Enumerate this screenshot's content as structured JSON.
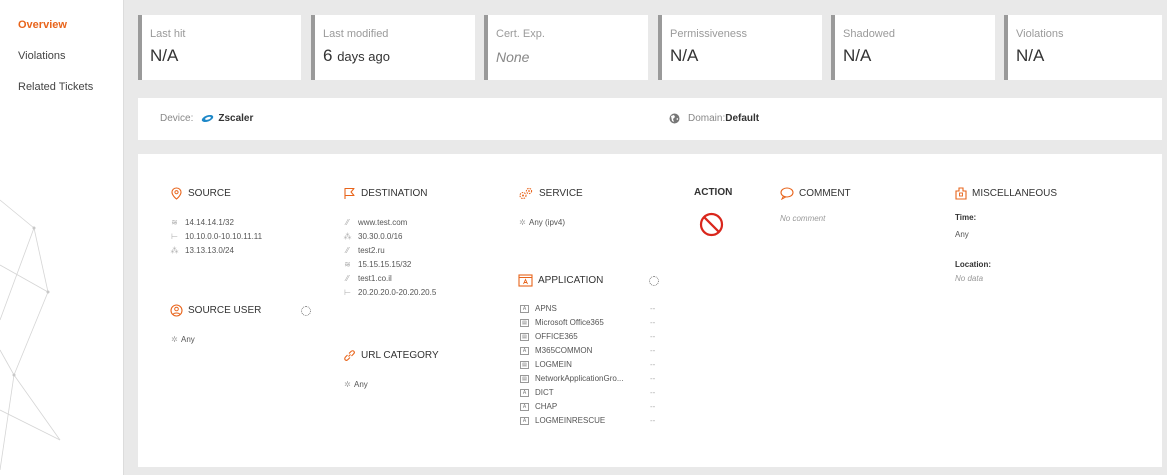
{
  "sidebar": {
    "items": [
      {
        "label": "Overview",
        "active": true
      },
      {
        "label": "Violations",
        "active": false
      },
      {
        "label": "Related Tickets",
        "active": false
      }
    ]
  },
  "cards": [
    {
      "label": "Last hit",
      "value": "N/A"
    },
    {
      "label": "Last modified",
      "value_num": "6",
      "value_unit": "days ago"
    },
    {
      "label": "Cert. Exp.",
      "value": "None"
    },
    {
      "label": "Permissiveness",
      "value": "N/A"
    },
    {
      "label": "Shadowed",
      "value": "N/A"
    },
    {
      "label": "Violations",
      "value": "N/A"
    }
  ],
  "device": {
    "label": "Device:",
    "name": "Zscaler",
    "domain_label": "Domain:",
    "domain_value": "Default"
  },
  "source": {
    "title": "SOURCE",
    "items": [
      "14.14.14.1/32",
      "10.10.0.0-10.10.11.11",
      "13.13.13.0/24"
    ]
  },
  "source_user": {
    "title": "SOURCE USER",
    "items": [
      "Any"
    ]
  },
  "destination": {
    "title": "DESTINATION",
    "items": [
      "www.test.com",
      "30.30.0.0/16",
      "test2.ru",
      "15.15.15.15/32",
      "test1.co.il",
      "20.20.20.0-20.20.20.5"
    ]
  },
  "url_category": {
    "title": "URL CATEGORY",
    "items": [
      "Any"
    ]
  },
  "service": {
    "title": "SERVICE",
    "items": [
      "Any (ipv4)"
    ]
  },
  "application": {
    "title": "APPLICATION",
    "items": [
      {
        "name": "APNS",
        "value": "--"
      },
      {
        "name": "Microsoft Office365",
        "value": "--"
      },
      {
        "name": "OFFICE365",
        "value": "--"
      },
      {
        "name": "M365COMMON",
        "value": "--"
      },
      {
        "name": "LOGMEIN",
        "value": "--"
      },
      {
        "name": "NetworkApplicationGro...",
        "value": "--"
      },
      {
        "name": "DICT",
        "value": "--"
      },
      {
        "name": "CHAP",
        "value": "--"
      },
      {
        "name": "LOGMEINRESCUE",
        "value": "--"
      }
    ]
  },
  "action": {
    "title": "ACTION",
    "icon": "deny-icon",
    "color": "#d9261c"
  },
  "comment": {
    "title": "COMMENT",
    "text": "No comment"
  },
  "misc": {
    "title": "MISCELLANEOUS",
    "time_label": "Time:",
    "time_value": "Any",
    "location_label": "Location:",
    "location_value": "No data"
  },
  "colors": {
    "accent": "#e8641b",
    "deny": "#d9261c"
  }
}
